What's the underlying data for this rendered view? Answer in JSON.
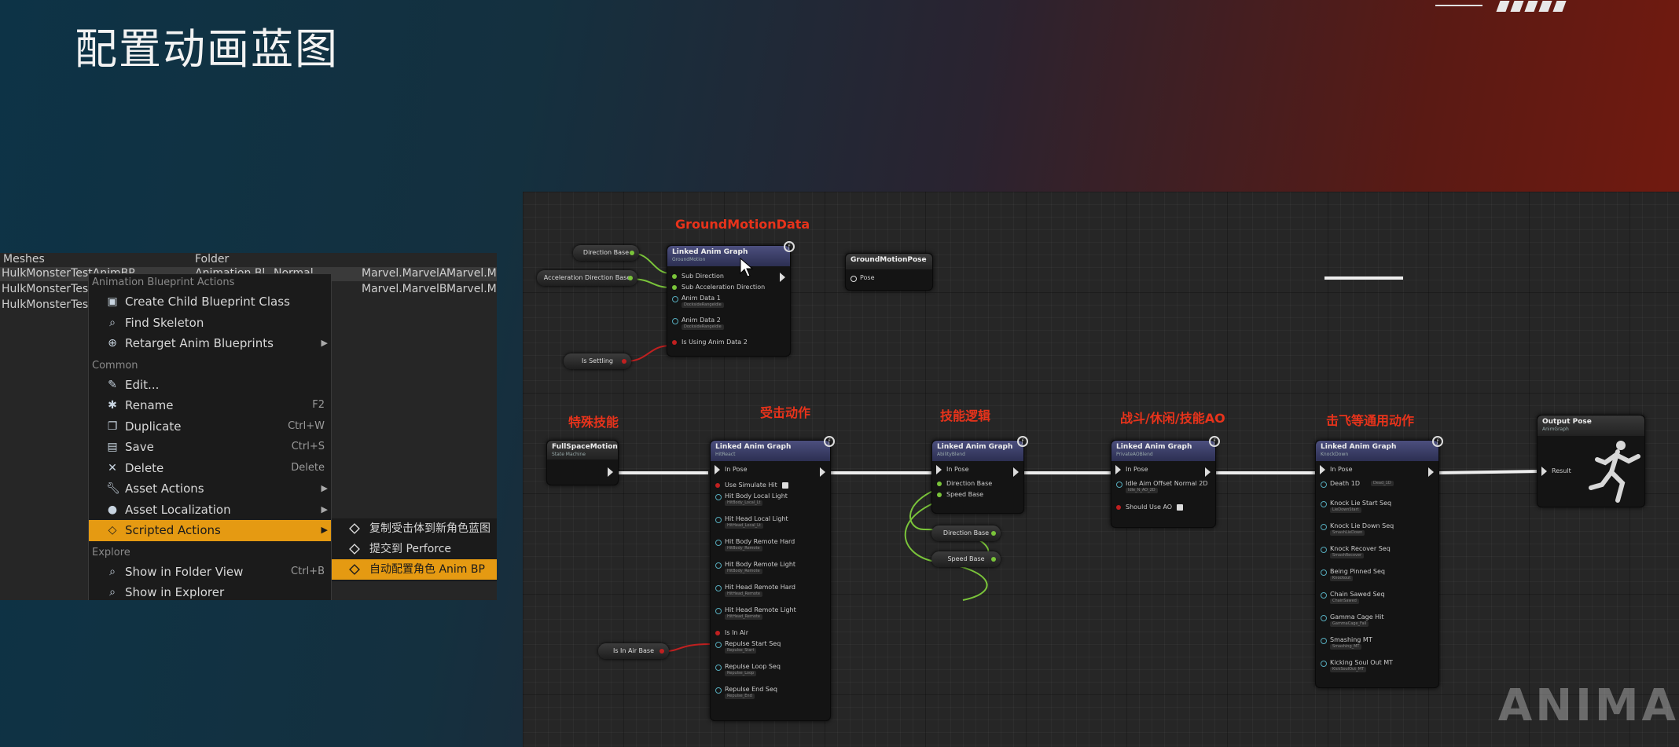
{
  "slide": {
    "title": "配置动画蓝图",
    "watermark": "ANIMA"
  },
  "content_browser": {
    "header_row": {
      "name": "Meshes",
      "type": "Folder"
    },
    "rows": [
      {
        "name": "HulkMonsterTestAnimBP",
        "type": "Animation Bl",
        "mode": "Normal",
        "c1": "Marvel.MarvelA",
        "c2": "Marvel.Ma"
      },
      {
        "name": "HulkMonsterTest",
        "type": "",
        "mode": "",
        "c1": "Marvel.MarvelB",
        "c2": "Marvel.Ma"
      },
      {
        "name": "HulkMonsterTest",
        "type": "",
        "mode": "",
        "c1": "",
        "c2": ""
      }
    ]
  },
  "context_menu": {
    "section_anim": "Animation Blueprint Actions",
    "anim_items": [
      {
        "label": "Create Child Blueprint Class",
        "icon": "blueprint-icon"
      },
      {
        "label": "Find Skeleton",
        "icon": "search-icon"
      },
      {
        "label": "Retarget Anim Blueprints",
        "icon": "retarget-icon",
        "submenu": true
      }
    ],
    "section_common": "Common",
    "common_items": [
      {
        "label": "Edit...",
        "icon": "edit-icon",
        "shortcut": ""
      },
      {
        "label": "Rename",
        "icon": "rename-icon",
        "shortcut": "F2"
      },
      {
        "label": "Duplicate",
        "icon": "duplicate-icon",
        "shortcut": "Ctrl+W"
      },
      {
        "label": "Save",
        "icon": "save-icon",
        "shortcut": "Ctrl+S"
      },
      {
        "label": "Delete",
        "icon": "delete-icon",
        "shortcut": "Delete"
      },
      {
        "label": "Asset Actions",
        "icon": "wrench-icon",
        "submenu": true
      },
      {
        "label": "Asset Localization",
        "icon": "globe-icon",
        "submenu": true
      },
      {
        "label": "Scripted Actions",
        "icon": "diamond-icon",
        "submenu": true,
        "highlighted": true
      }
    ],
    "section_explore": "Explore",
    "explore_items": [
      {
        "label": "Show in Folder View",
        "icon": "search-icon",
        "shortcut": "Ctrl+B"
      },
      {
        "label": "Show in Explorer",
        "icon": "search-icon",
        "shortcut": ""
      }
    ],
    "submenu_items": [
      {
        "label": "复制受击体到新角色蓝图"
      },
      {
        "label": "提交到 Perforce"
      },
      {
        "label": "自动配置角色 Anim BP",
        "highlighted": true
      }
    ]
  },
  "graph": {
    "annotations": {
      "ground": "GroundMotionData",
      "special": "特殊技能",
      "hit": "受击动作",
      "skill": "技能逻辑",
      "combat": "战斗/休闲/技能AO",
      "knock": "击飞等通用动作"
    },
    "vars": {
      "direction": "Direction Base",
      "accel": "Acceleration Direction Base",
      "settling": "Is Settling",
      "air": "Is In Air Base",
      "dir2": "Direction Base",
      "speed2": "Speed Base"
    },
    "ground_node": {
      "title": "Linked Anim Graph",
      "subtitle": "GroundMotion",
      "pins": [
        "Sub Direction",
        "Sub Acceleration Direction",
        "Anim Data 1",
        "Anim Data 2",
        "Is Using Anim Data 2"
      ],
      "pin_values": [
        "",
        "",
        "DocksideRangeIdle",
        "DocksideRangeIdle",
        ""
      ]
    },
    "pose_node": {
      "title": "GroundMotionPose",
      "pin": "Pose"
    },
    "fullspace_node": {
      "title": "FullSpaceMotion",
      "subtitle": "State Machine"
    },
    "hit_node": {
      "title": "Linked Anim Graph",
      "subtitle": "HitReact",
      "in_pose": "In Pose",
      "pins": [
        "Use Simulate Hit",
        "Hit Body Local Light",
        "Hit Head Local Light",
        "Hit Body Remote Hard",
        "Hit Body Remote Light",
        "Hit Head Remote Hard",
        "Hit Head Remote Light",
        "Is In Air",
        "Repulse Start Seq",
        "Repulse Loop Seq",
        "Repulse End Seq"
      ],
      "pin_values": [
        "",
        "HitBody_Local_Lt",
        "HitHead_Local_Lt",
        "HitBody_Remote",
        "HitBody_Remote",
        "HitHead_Remote",
        "HitHead_Remote",
        "",
        "Repulse_Start",
        "Repulse_Loop",
        "Repulse_End"
      ]
    },
    "skill_node": {
      "title": "Linked Anim Graph",
      "subtitle": "AbilityBlend",
      "in_pose": "In Pose",
      "pins": [
        "Direction Base",
        "Speed Base"
      ]
    },
    "combat_node": {
      "title": "Linked Anim Graph",
      "subtitle": "PrivateAOBlend",
      "in_pose": "In Pose",
      "pins": [
        "Idle Aim Offset Normal 2D",
        "Should Use AO"
      ],
      "pin_values": [
        "Idle_N_AO_2D",
        ""
      ]
    },
    "knock_node": {
      "title": "Linked Anim Graph",
      "subtitle": "KnockDown",
      "in_pose": "In Pose",
      "pins": [
        "Death 1D",
        "Knock Lie Start Seq",
        "Knock Lie Down Seq",
        "Knock Recover Seq",
        "Being Pinned Seq",
        "Chain Sawed Seq",
        "Gamma Cage Hit",
        "Smashing MT",
        "Kicking Soul Out MT"
      ],
      "pin_values": [
        "Dead_1D",
        "LieDownStart",
        "SmashLieDown",
        "SmashRecover",
        "Knockout",
        "ChainSawed",
        "GammaCage_Fall",
        "Smashing_MT",
        "KickSoulOut_MT"
      ]
    },
    "output_node": {
      "title": "Output Pose",
      "subtitle": "AnimGraph",
      "pin": "Result"
    }
  }
}
